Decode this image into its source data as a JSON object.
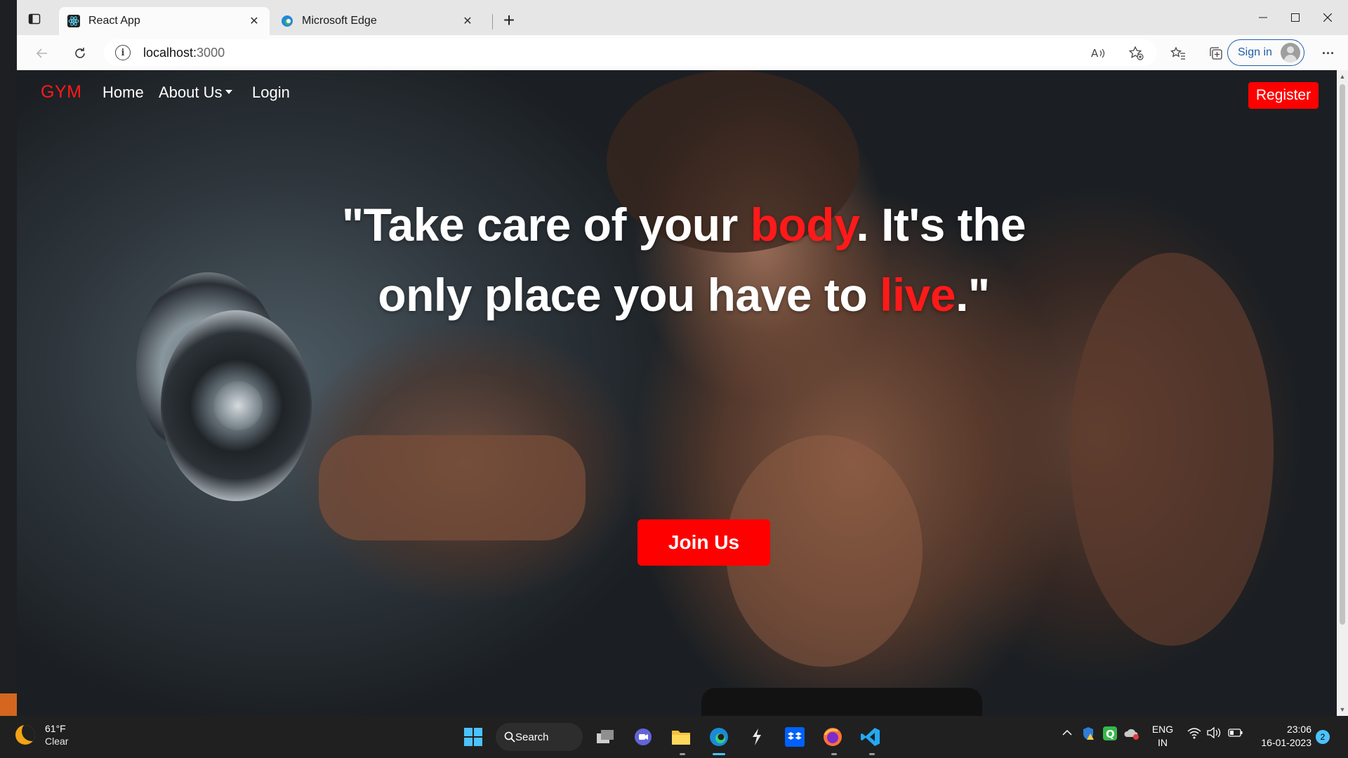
{
  "browser": {
    "tabs": [
      {
        "title": "React App",
        "active": true,
        "icon": "react-icon"
      },
      {
        "title": "Microsoft Edge",
        "active": false,
        "icon": "edge-icon"
      }
    ],
    "url_host": "localhost:",
    "url_port": "3000",
    "sign_in_label": "Sign in",
    "close_glyph": "✕",
    "new_tab_glyph": "+",
    "more_glyph": "···"
  },
  "site": {
    "brand": "GYM",
    "nav": [
      {
        "label": "Home"
      },
      {
        "label": "About Us",
        "dropdown": true
      },
      {
        "label": "Login"
      }
    ],
    "register_label": "Register",
    "hero": {
      "part1": "\"Take care of your ",
      "highlight1": "body",
      "part2": ". It's the only place you have to ",
      "highlight2": "live",
      "part3": ".\""
    },
    "join_label": "Join Us",
    "colors": {
      "accent": "#ff0000"
    }
  },
  "taskbar": {
    "weather_temp": "61°F",
    "weather_cond": "Clear",
    "search_label": "Search",
    "lang_line1": "ENG",
    "lang_line2": "IN",
    "time": "23:06",
    "date": "16-01-2023",
    "notifications": "2"
  }
}
